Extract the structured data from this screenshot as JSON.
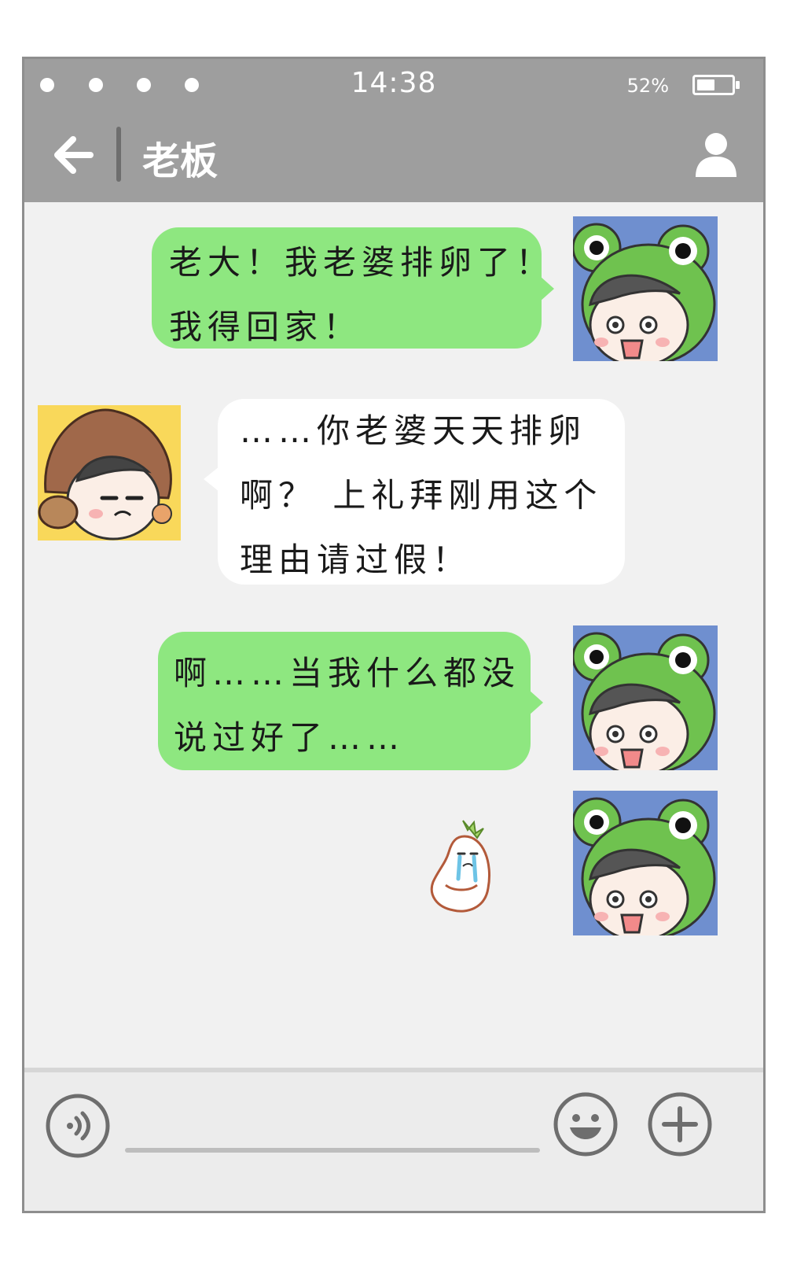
{
  "status_bar": {
    "time": "14:38",
    "battery_percent_label": "52%",
    "battery_level": 0.52,
    "signal_dots": 4
  },
  "nav": {
    "title": "老板",
    "back_icon": "arrow-left-icon",
    "profile_icon": "person-icon"
  },
  "messages": [
    {
      "side": "right",
      "sender": "me",
      "lines": [
        "老大！我老婆排卵了！",
        "我得回家！"
      ]
    },
    {
      "side": "left",
      "sender": "boss",
      "lines": [
        "……你老婆天天排卵",
        "啊？ 上礼拜刚用这个",
        "理由请过假！"
      ]
    },
    {
      "side": "right",
      "sender": "me",
      "lines": [
        "啊……当我什么都没",
        "说过好了……"
      ]
    },
    {
      "side": "right",
      "sender": "me",
      "type": "sticker",
      "sticker": "crying-radish-sticker"
    }
  ],
  "input_bar": {
    "voice_icon": "voice-icon",
    "emoji_icon": "smiley-icon",
    "more_icon": "plus-icon"
  },
  "colors": {
    "header": "#9e9e9e",
    "chat_bg": "#f1f1f1",
    "my_bubble": "#8ee780",
    "their_bubble": "#ffffff",
    "input_bar": "#ececec"
  }
}
